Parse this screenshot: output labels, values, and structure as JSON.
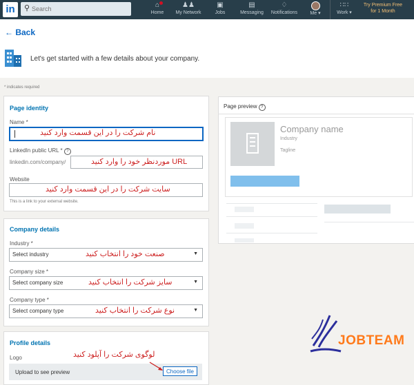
{
  "nav": {
    "logo": "in",
    "search_placeholder": "Search",
    "items": [
      {
        "label": "Home",
        "icon": "home-icon"
      },
      {
        "label": "My Network",
        "icon": "people-icon"
      },
      {
        "label": "Jobs",
        "icon": "briefcase-icon"
      },
      {
        "label": "Messaging",
        "icon": "chat-icon"
      },
      {
        "label": "Notifications",
        "icon": "bell-icon"
      },
      {
        "label": "Me ▾",
        "icon": "avatar"
      },
      {
        "label": "Work ▾",
        "icon": "grid-icon"
      }
    ],
    "premium_line1": "Try Premium Free",
    "premium_line2": "for 1 Month"
  },
  "header": {
    "back": "Back",
    "intro": "Let's get started with a few details about your company."
  },
  "required_note": "* indicates required",
  "page_identity": {
    "title": "Page identity",
    "name_label": "Name *",
    "name_note": "نام شرکت را در این قسمت وارد کنید",
    "url_label": "LinkedIn public URL *",
    "url_prefix": "linkedin.com/company/",
    "url_note": "URL موردنظر خود را وارد کنید",
    "website_label": "Website",
    "website_note": "سایت شرکت را در این قسمت وارد کنید",
    "website_hint": "This is a link to your external website."
  },
  "company_details": {
    "title": "Company details",
    "industry_label": "Industry *",
    "industry_value": "Select industry",
    "industry_note": "صنعت خود را انتخاب کنید",
    "size_label": "Company size *",
    "size_value": "Select company size",
    "size_note": "سایز شرکت را انتخاب کنید",
    "type_label": "Company type *",
    "type_value": "Select company type",
    "type_note": "نوع شرکت را انتخاب کنید"
  },
  "profile_details": {
    "title": "Profile details",
    "logo_label": "Logo",
    "logo_note": "لوگوی شرکت را آپلود کنید",
    "upload_text": "Upload to see preview",
    "choose_file": "Choose file"
  },
  "preview": {
    "title": "Page preview",
    "company_name": "Company name",
    "industry": "Industry",
    "tagline": "Tagline"
  },
  "watermark": "JOBTEAM",
  "colors": {
    "nav_bg": "#283e4a",
    "accent": "#0a66c2",
    "note_red": "#cc1f1f",
    "premium_gold": "#f5c075",
    "watermark_orange": "#ff7a1a",
    "watermark_blue": "#2c2f9c"
  }
}
